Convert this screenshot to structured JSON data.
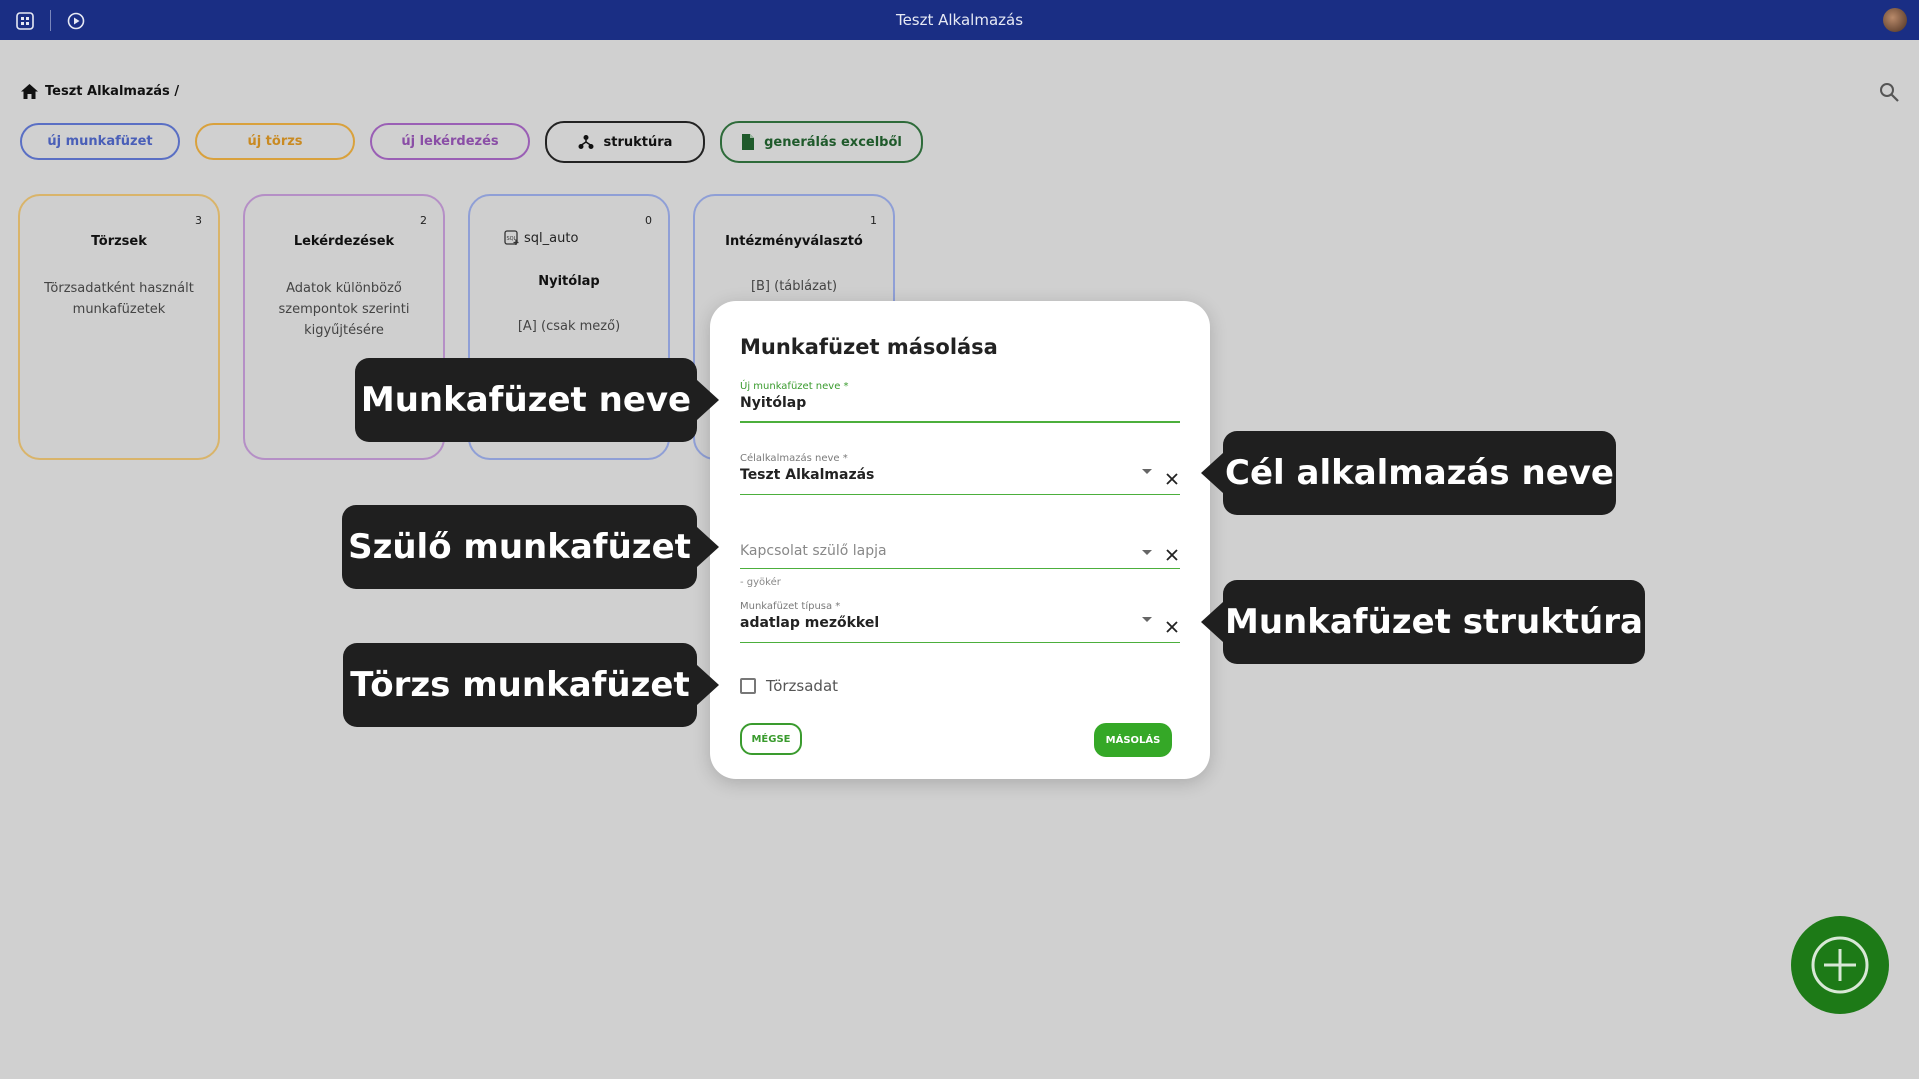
{
  "app": {
    "title": "Teszt Alkalmazás"
  },
  "breadcrumb": {
    "text": "Teszt Alkalmazás /"
  },
  "actions": {
    "new_workbook": "új munkafüzet",
    "new_master": "új törzs",
    "new_query": "új lekérdezés",
    "structure": "struktúra",
    "generate_excel": "generálás excelből"
  },
  "cards": [
    {
      "title": "Törzsek",
      "count": "3",
      "desc": "Törzsadatként használt munkafüzetek"
    },
    {
      "title": "Lekérdezések",
      "count": "2",
      "desc": "Adatok különböző szempontok szerinti kigyűjtésére"
    },
    {
      "title": "Nyitólap",
      "count": "0",
      "tag": "sql_auto",
      "desc": "[A] (csak mező)"
    },
    {
      "title": "Intézményválasztó",
      "count": "1",
      "desc": "[B] (táblázat)"
    }
  ],
  "dialog": {
    "title": "Munkafüzet másolása",
    "name_label": "Új munkafüzet neve *",
    "name_value": "Nyitólap",
    "target_label": "Célalkalmazás neve *",
    "target_value": "Teszt Alkalmazás",
    "parent_placeholder": "Kapcsolat szülő lapja",
    "parent_hint": "- gyökér",
    "type_label": "Munkafüzet típusa *",
    "type_value": "adatlap mezőkkel",
    "master_checkbox_label": "Törzsadat",
    "cancel_label": "MÉGSE",
    "copy_label": "MÁSOLÁS"
  },
  "callouts": {
    "workbook_name": "Munkafüzet neve",
    "target_app": "Cél alkalmazás neve",
    "parent_workbook": "Szülő munkafüzet",
    "workbook_structure": "Munkafüzet struktúra",
    "master_workbook": "Törzs munkafüzet"
  },
  "colors": {
    "topbar": "#1a2e84",
    "blue": "#5a6fc4",
    "orange": "#d9a13c",
    "purple": "#9a5fb5",
    "green": "#35a827",
    "fab": "#1d7a17"
  },
  "icons": [
    "apps-icon",
    "play-circle-icon",
    "home-icon",
    "search-icon",
    "structure-icon",
    "sheet-icon",
    "sql-icon",
    "close-icon",
    "plus-circle-icon"
  ]
}
